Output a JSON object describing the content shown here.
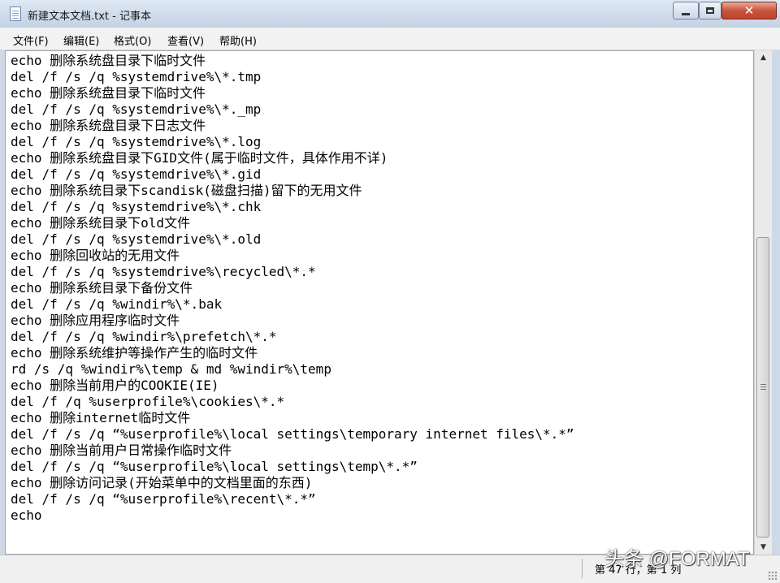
{
  "window": {
    "title": "新建文本文档.txt - 记事本",
    "close_symbol": "✕"
  },
  "menu": [
    {
      "label": "文件(F)"
    },
    {
      "label": "编辑(E)"
    },
    {
      "label": "格式(O)"
    },
    {
      "label": "查看(V)"
    },
    {
      "label": "帮助(H)"
    }
  ],
  "editor": {
    "lines": [
      "echo 删除系统盘目录下临时文件",
      "del /f /s /q %systemdrive%\\*.tmp",
      "echo 删除系统盘目录下临时文件",
      "del /f /s /q %systemdrive%\\*._mp",
      "echo 删除系统盘目录下日志文件",
      "del /f /s /q %systemdrive%\\*.log",
      "echo 删除系统盘目录下GID文件(属于临时文件，具体作用不详)",
      "del /f /s /q %systemdrive%\\*.gid",
      "echo 删除系统目录下scandisk(磁盘扫描)留下的无用文件",
      "del /f /s /q %systemdrive%\\*.chk",
      "echo 删除系统目录下old文件",
      "del /f /s /q %systemdrive%\\*.old",
      "echo 删除回收站的无用文件",
      "del /f /s /q %systemdrive%\\recycled\\*.*",
      "echo 删除系统目录下备份文件",
      "del /f /s /q %windir%\\*.bak",
      "echo 删除应用程序临时文件",
      "del /f /s /q %windir%\\prefetch\\*.*",
      "echo 删除系统维护等操作产生的临时文件",
      "rd /s /q %windir%\\temp & md %windir%\\temp",
      "echo 删除当前用户的COOKIE(IE)",
      "del /f /q %userprofile%\\cookies\\*.*",
      "echo 删除internet临时文件",
      "del /f /s /q “%userprofile%\\local settings\\temporary internet files\\*.*”",
      "echo 删除当前用户日常操作临时文件",
      "del /f /s /q “%userprofile%\\local settings\\temp\\*.*”",
      "echo 删除访问记录(开始菜单中的文档里面的东西)",
      "del /f /s /q “%userprofile%\\recent\\*.*”",
      "echo"
    ]
  },
  "scrollbar": {
    "up_arrow": "▲",
    "down_arrow": "▼"
  },
  "statusbar": {
    "position": "第 47 行，第 1 列"
  },
  "watermark": {
    "text": "头条 @FORMAT"
  },
  "colors": {
    "close_button": "#c8553d",
    "titlebar": "#c3d2e4"
  }
}
